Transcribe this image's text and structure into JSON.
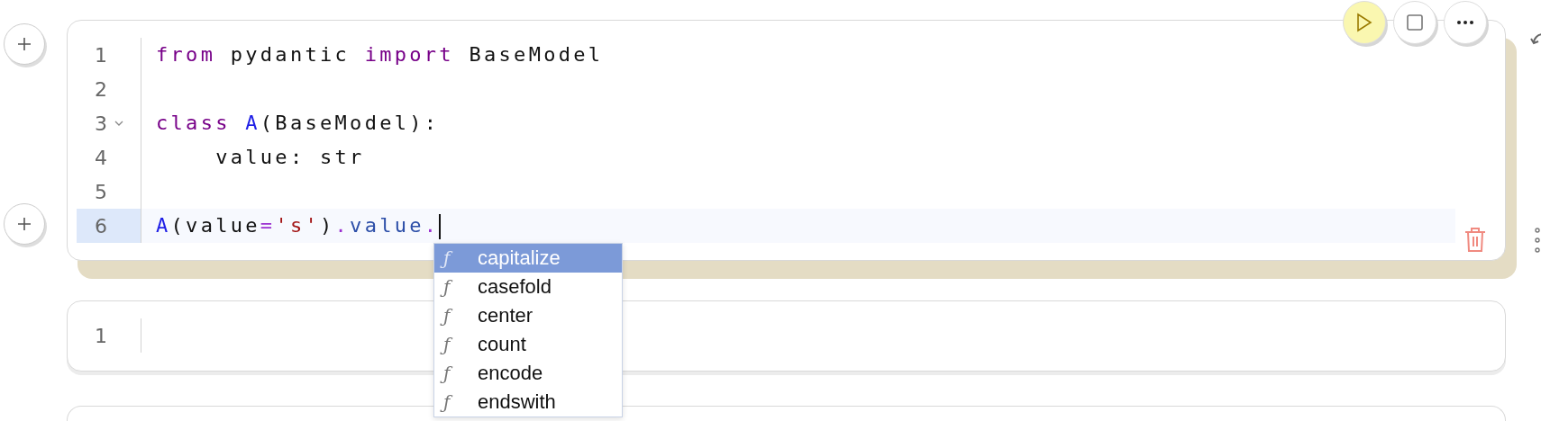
{
  "cells": [
    {
      "lines": [
        {
          "number": "1",
          "active": false,
          "tokens": [
            {
              "kind": "keyword",
              "text": "from"
            },
            {
              "kind": "plain",
              "text": " pydantic "
            },
            {
              "kind": "keyword",
              "text": "import"
            },
            {
              "kind": "plain",
              "text": " BaseModel"
            }
          ]
        },
        {
          "number": "2",
          "active": false
        },
        {
          "number": "3",
          "active": false,
          "foldable": true,
          "tokens": [
            {
              "kind": "keyword",
              "text": "class "
            },
            {
              "kind": "def",
              "text": "A"
            },
            {
              "kind": "plain",
              "text": "(BaseModel):"
            }
          ]
        },
        {
          "number": "4",
          "active": false,
          "tokens": [
            {
              "kind": "plain",
              "text": "    value: str"
            }
          ]
        },
        {
          "number": "5",
          "active": false
        },
        {
          "number": "6",
          "active": true,
          "tokens": [
            {
              "kind": "def",
              "text": "A"
            },
            {
              "kind": "plain",
              "text": "(value"
            },
            {
              "kind": "operator",
              "text": "="
            },
            {
              "kind": "string",
              "text": "'s'"
            },
            {
              "kind": "plain",
              "text": ")"
            },
            {
              "kind": "operator",
              "text": "."
            },
            {
              "kind": "property",
              "text": "value"
            },
            {
              "kind": "operator",
              "text": "."
            }
          ]
        }
      ],
      "completions": [
        {
          "icon": "ƒ",
          "label": "capitalize",
          "selected": true
        },
        {
          "icon": "ƒ",
          "label": "casefold",
          "selected": false
        },
        {
          "icon": "ƒ",
          "label": "center",
          "selected": false
        },
        {
          "icon": "ƒ",
          "label": "count",
          "selected": false
        },
        {
          "icon": "ƒ",
          "label": "encode",
          "selected": false
        },
        {
          "icon": "ƒ",
          "label": "endswith",
          "selected": false
        }
      ]
    },
    {
      "lines": [
        {
          "number": "1",
          "active": false
        }
      ]
    },
    {
      "kind": "cut"
    }
  ]
}
